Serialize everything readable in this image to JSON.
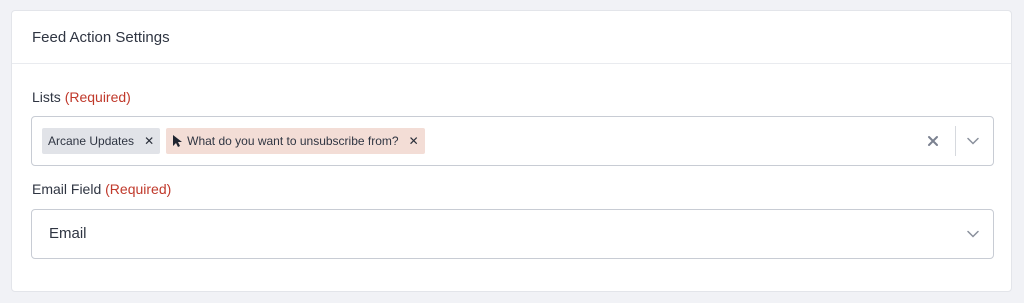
{
  "panel": {
    "title": "Feed Action Settings"
  },
  "lists": {
    "label": "Lists",
    "required": "(Required)",
    "tags": [
      {
        "label": "Arcane Updates"
      },
      {
        "label": "What do you want to unsubscribe from?"
      }
    ]
  },
  "email_field": {
    "label": "Email Field",
    "required": "(Required)",
    "value": "Email"
  },
  "colors": {
    "required": "#c0392b",
    "tag_gray": "#e1e3e8",
    "tag_peach": "#f3ddd6"
  },
  "icons": {
    "remove_tag": "x-icon",
    "clear": "clear-x-icon",
    "dropdown": "chevron-down-icon",
    "cursor": "mouse-pointer-icon"
  }
}
